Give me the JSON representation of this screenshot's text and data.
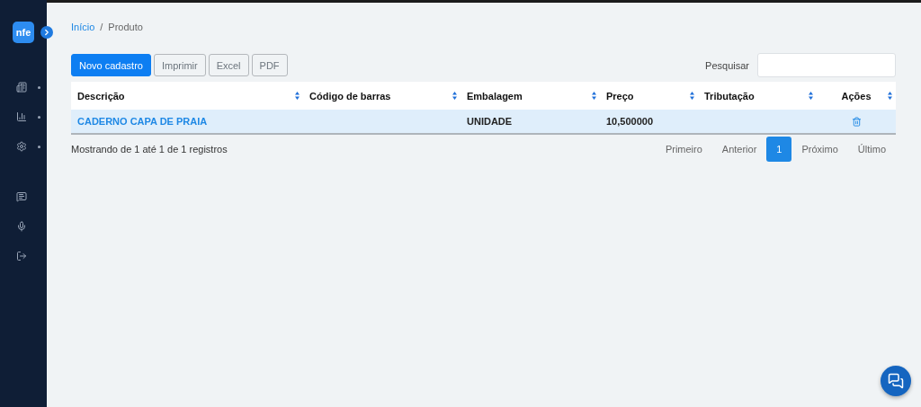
{
  "logo": {
    "text": "nfe"
  },
  "sidebar": {
    "items": [
      {
        "kind": "news",
        "has_submenu": true
      },
      {
        "kind": "chart",
        "has_submenu": true
      },
      {
        "kind": "settings",
        "has_submenu": true
      }
    ],
    "bottom_items": [
      {
        "kind": "help"
      },
      {
        "kind": "mic"
      },
      {
        "kind": "logout"
      }
    ]
  },
  "breadcrumb": [
    {
      "label": "Início",
      "link": true
    },
    {
      "label": "Produto",
      "link": false
    }
  ],
  "breadcrumb_separator": "/",
  "buttons": [
    {
      "label": "Novo cadastro",
      "primary": true
    },
    {
      "label": "Imprimir",
      "primary": false
    },
    {
      "label": "Excel",
      "primary": false
    },
    {
      "label": "PDF",
      "primary": false
    }
  ],
  "search": {
    "label": "Pesquisar"
  },
  "table": {
    "columns": [
      {
        "label": "Descrição",
        "centered": false
      },
      {
        "label": "Código de barras",
        "centered": false
      },
      {
        "label": "Embalagem",
        "centered": false
      },
      {
        "label": "Preço",
        "centered": false
      },
      {
        "label": "Tributação",
        "centered": false
      },
      {
        "label": "Ações",
        "centered": true
      }
    ],
    "rows": [
      {
        "description": "CADERNO CAPA DE PRAIA",
        "packaging": "UNIDADE",
        "price": "10,500000",
        "selected": true
      }
    ]
  },
  "info": "Mostrando de 1 até 1 de 1 registros",
  "pagination": [
    {
      "label": "Primeiro",
      "selected": false
    },
    {
      "label": "Anterior",
      "selected": false
    },
    {
      "label": "1",
      "selected": true
    },
    {
      "label": "Próximo",
      "selected": false
    },
    {
      "label": "Último",
      "selected": false
    }
  ]
}
